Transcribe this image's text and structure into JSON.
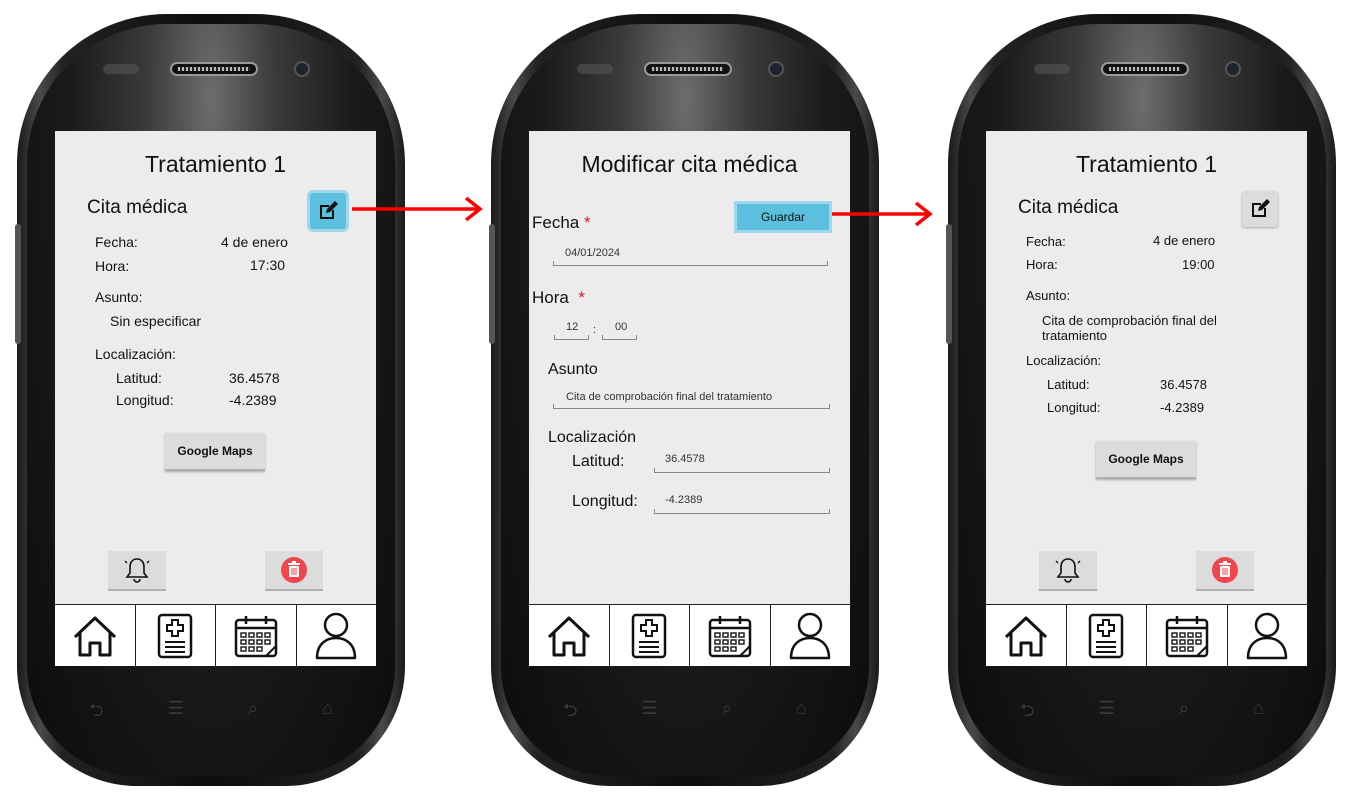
{
  "screens": [
    {
      "title": "Tratamiento 1",
      "section": "Cita médica",
      "fecha_label": "Fecha:",
      "fecha_value": "4 de enero",
      "hora_label": "Hora:",
      "hora_value": "17:30",
      "asunto_label": "Asunto:",
      "asunto_value": "Sin especificar",
      "localizacion_label": "Localización:",
      "latitud_label": "Latitud:",
      "latitud_value": "36.4578",
      "longitud_label": "Longitud:",
      "longitud_value": "-4.2389",
      "maps_button": "Google Maps",
      "edit_icon": "edit-icon",
      "edit_state": "active"
    },
    {
      "title": "Modificar cita médica",
      "fecha_label": "Fecha",
      "required_mark": "*",
      "save_button": "Guardar",
      "fecha_value": "04/01/2024",
      "hora_label": "Hora",
      "hora_hours": "12",
      "hora_sep": ":",
      "hora_minutes": "00",
      "asunto_label": "Asunto",
      "asunto_value": "Cita de comprobación final del tratamiento",
      "localizacion_label": "Localización",
      "latitud_label": "Latitud:",
      "latitud_value": "36.4578",
      "longitud_label": "Longitud:",
      "longitud_value": "-4.2389"
    },
    {
      "title": "Tratamiento 1",
      "section": "Cita médica",
      "fecha_label": "Fecha:",
      "fecha_value": "4 de enero",
      "hora_label": "Hora:",
      "hora_value": "19:00",
      "asunto_label": "Asunto:",
      "asunto_value": "Cita de comprobación final del tratamiento",
      "localizacion_label": "Localización:",
      "latitud_label": "Latitud:",
      "latitud_value": "36.4578",
      "longitud_label": "Longitud:",
      "longitud_value": "-4.2389",
      "maps_button": "Google Maps",
      "edit_icon": "edit-icon",
      "edit_state": "normal"
    }
  ],
  "tabbar_icons": [
    "home-icon",
    "medical-record-icon",
    "calendar-icon",
    "profile-icon"
  ],
  "bottom_icons": [
    "bell-icon",
    "trash-icon"
  ],
  "colors": {
    "accent": "#5bc0de",
    "arrow": "#ff0000",
    "delete": "#f0474f",
    "required": "#e0162b"
  }
}
